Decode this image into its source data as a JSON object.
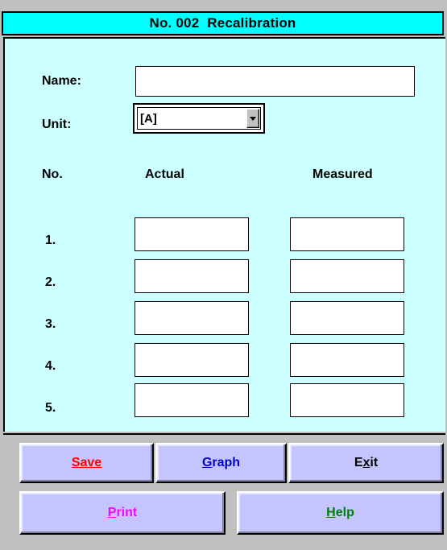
{
  "window": {
    "title": "No. 002  Recalibration"
  },
  "form": {
    "name_label": "Name:",
    "name_value": "",
    "unit_label": "Unit:",
    "unit_value": "[A]"
  },
  "table": {
    "headers": {
      "no": "No.",
      "actual": "Actual",
      "measured": "Measured"
    },
    "rows": [
      {
        "no": "1.",
        "actual": "",
        "measured": ""
      },
      {
        "no": "2.",
        "actual": "",
        "measured": ""
      },
      {
        "no": "3.",
        "actual": "",
        "measured": ""
      },
      {
        "no": "4.",
        "actual": "",
        "measured": ""
      },
      {
        "no": "5.",
        "actual": "",
        "measured": ""
      }
    ]
  },
  "buttons": {
    "save": {
      "mnemonic": "S",
      "rest": "ave",
      "color": "#ff0000"
    },
    "graph": {
      "mnemonic": "G",
      "rest": "raph",
      "color": "#0000cc"
    },
    "exit": {
      "pre": "E",
      "mnemonic": "x",
      "rest": "it",
      "color": "#000000"
    },
    "print": {
      "mnemonic": "P",
      "rest": "rint",
      "color": "#ff00ff"
    },
    "help": {
      "mnemonic": "H",
      "rest": "elp",
      "color": "#008000"
    }
  },
  "colors": {
    "titlebar": "#00ffff",
    "content_bg": "#ccffff",
    "button_face": "#c4c4ff"
  }
}
